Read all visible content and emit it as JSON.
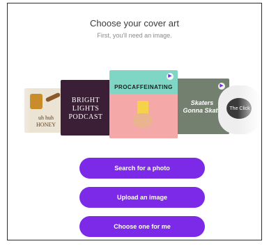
{
  "dialog": {
    "title": "Choose your cover art",
    "subtitle": "First, you'll need an image."
  },
  "carousel": {
    "cards": [
      {
        "label": "uh huh\nHONEY",
        "icon": "honey-jar"
      },
      {
        "label": "BRIGHT\nLIGHTS\nPODCAST",
        "icon": "none"
      },
      {
        "label": "PROCAFFEINATING",
        "icon": "speaker-icon"
      },
      {
        "label": "Skaters\nGonna Skate",
        "icon": "speaker-icon"
      },
      {
        "label": "The Click",
        "icon": "none"
      }
    ]
  },
  "actions": {
    "search_label": "Search for a photo",
    "upload_label": "Upload an image",
    "choose_label": "Choose one for me"
  },
  "colors": {
    "accent": "#7d2ae8"
  }
}
